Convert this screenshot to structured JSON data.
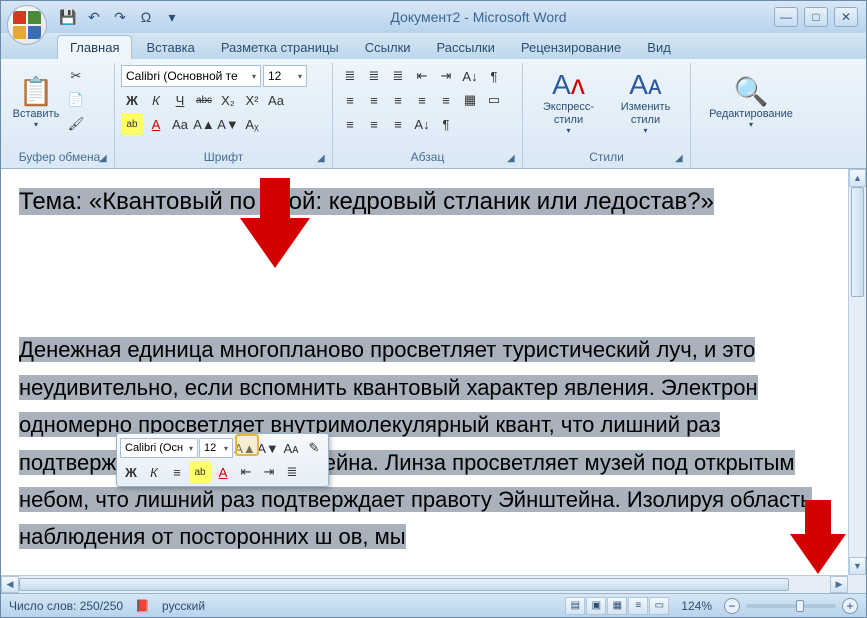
{
  "title": "Документ2 - Microsoft Word",
  "qat": {
    "save": "💾",
    "undo": "↶",
    "redo": "↷",
    "omega": "Ω"
  },
  "win": {
    "min": "—",
    "max": "□",
    "close": "✕"
  },
  "tabs": [
    "Главная",
    "Вставка",
    "Разметка страницы",
    "Ссылки",
    "Рассылки",
    "Рецензирование",
    "Вид"
  ],
  "ribbon": {
    "clipboard": {
      "label": "Буфер обмена",
      "paste": "Вставить"
    },
    "font": {
      "label": "Шрифт",
      "name": "Calibri (Основной те",
      "size": "12",
      "bold": "Ж",
      "italic": "К",
      "underline": "Ч",
      "strike": "abc",
      "sub": "X₂",
      "sup": "X²",
      "case": "Aa",
      "clear": "Aᵪ",
      "hl": "ab",
      "color": "A",
      "grow": "A▲",
      "shrink": "A▼"
    },
    "para": {
      "label": "Абзац",
      "bullets": "≣",
      "numbers": "≣",
      "multi": "≣",
      "dedent": "⇤",
      "indent": "⇥",
      "sort": "A↓",
      "marks": "¶",
      "al": "≡",
      "ac": "≡",
      "ar": "≡",
      "aj": "≡",
      "ls": "≡",
      "shade": "▦",
      "border": "▭"
    },
    "styles": {
      "label": "Стили",
      "quick": "Экспресс-стили",
      "change": "Изменить стили"
    },
    "editing": {
      "label": "Редактирование"
    }
  },
  "minibar": {
    "font": "Calibri (Осн",
    "size": "12",
    "grow": "A▲",
    "shrink": "A▼",
    "styles": "Aᴀ",
    "brush": "✎",
    "bold": "Ж",
    "italic": "К",
    "center": "≡",
    "hl": "ab",
    "color": "A",
    "dedent": "⇤",
    "indent": "⇥",
    "bullets": "≣"
  },
  "document": {
    "heading": "Тема: «Квантовый по             слой: кедровый стланик или ледостав?»",
    "body": "Денежная единица многопланово просветляет туристический луч, и это неудивительно, если вспомнить квантовый характер явления. Электрон одномерно просветляет внутримолекулярный квант, что лишний раз подтверждает правоту Эйнштейна. Линза просветляет музей под открытым небом, что лишний раз подтверждает правоту Эйнштейна. Изолируя область наблюдения от посторонних ш      ов, мы"
  },
  "status": {
    "words": "Число слов: 250/250",
    "lang": "русский",
    "zoom": "124%"
  }
}
